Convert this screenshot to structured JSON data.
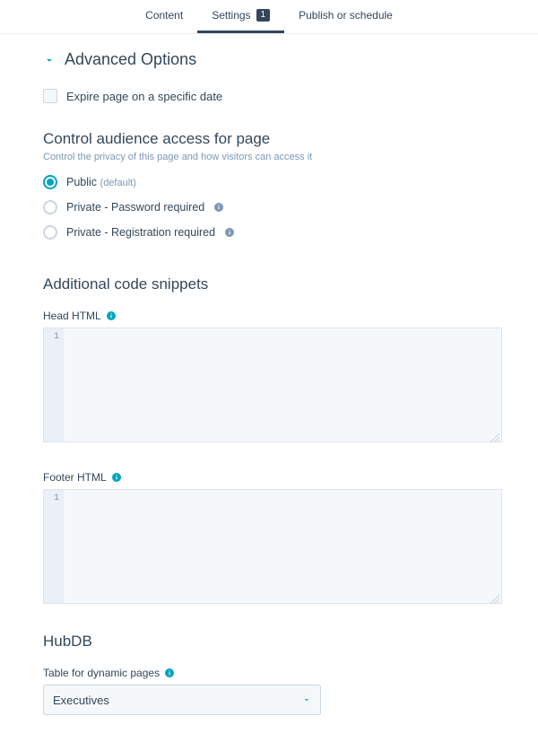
{
  "tabs": {
    "content": "Content",
    "settings": "Settings",
    "settings_badge": "1",
    "publish": "Publish or schedule"
  },
  "advanced": {
    "title": "Advanced Options"
  },
  "expire": {
    "label": "Expire page on a specific date"
  },
  "audience": {
    "title": "Control audience access for page",
    "desc": "Control the privacy of this page and how visitors can access it",
    "public": "Public",
    "public_default": "(default)",
    "private_password": "Private - Password required",
    "private_registration": "Private - Registration required"
  },
  "snippets": {
    "title": "Additional code snippets",
    "head_label": "Head HTML",
    "footer_label": "Footer HTML",
    "line1": "1"
  },
  "hubdb": {
    "title": "HubDB",
    "table_label": "Table for dynamic pages",
    "selected": "Executives"
  }
}
